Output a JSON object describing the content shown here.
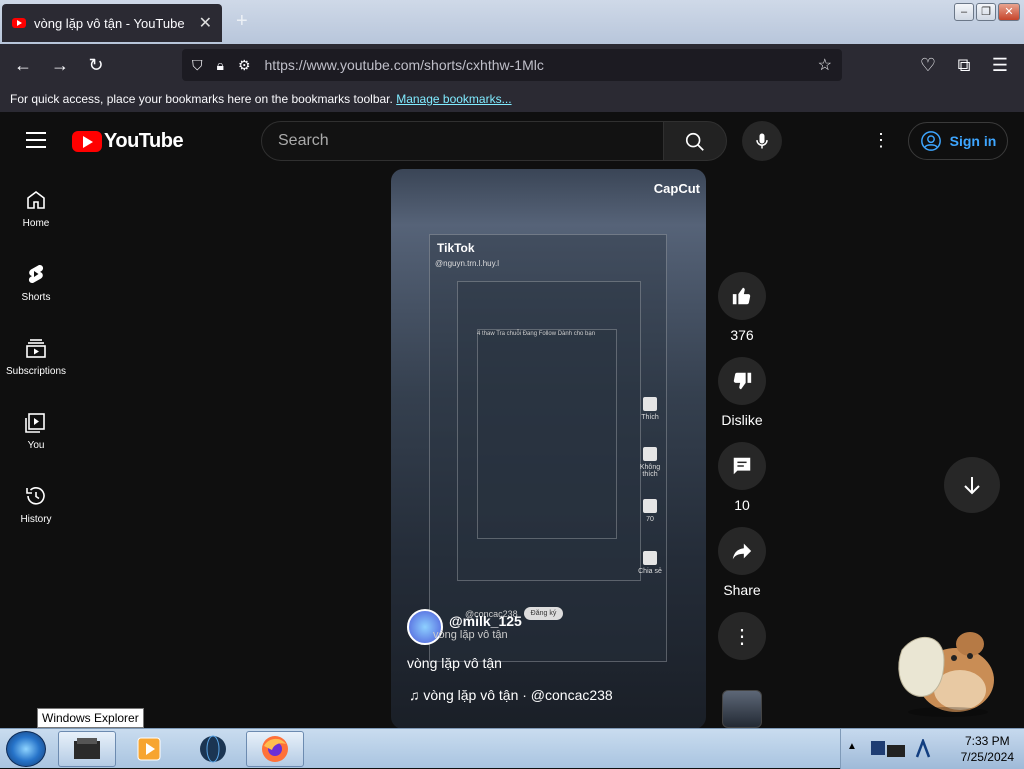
{
  "browser": {
    "tab_title": "vòng lặp vô tận - YouTube",
    "url": "https://www.youtube.com/shorts/cxhthw-1Mlc",
    "bookmark_text": "For quick access, place your bookmarks here on the bookmarks toolbar.",
    "bookmark_link": "Manage bookmarks..."
  },
  "youtube": {
    "logo_text": "YouTube",
    "search_placeholder": "Search",
    "sign_in": "Sign in",
    "sidebar": [
      {
        "label": "Home",
        "icon": "home-icon"
      },
      {
        "label": "Shorts",
        "icon": "shorts-icon"
      },
      {
        "label": "Subscriptions",
        "icon": "subscriptions-icon"
      },
      {
        "label": "You",
        "icon": "you-icon"
      },
      {
        "label": "History",
        "icon": "history-icon"
      }
    ],
    "short": {
      "capcut": "CapCut",
      "inner_tiktok": "TikTok",
      "inner_user": "@nguyn.trn.l.huy.l",
      "inner_tabs": "4 thaw    Tra chuỗi    Đang Follow    Dành cho bạn",
      "inner_handle": "@concac238",
      "inner_follow": "Đăng ký",
      "inner_like": "Thích",
      "inner_dislike": "Không thích",
      "inner_comments": "70",
      "inner_share": "Chia sẻ",
      "channel": "@milk_125",
      "channel_sub": "vòng lặp vô tận",
      "title": "vòng lặp vô tận",
      "music": "vòng lặp vô tận · @concac238"
    },
    "actions": {
      "likes": "376",
      "dislike": "Dislike",
      "comments": "10",
      "share": "Share"
    }
  },
  "taskbar": {
    "tooltip": "Windows Explorer",
    "time": "7:33 PM",
    "date": "7/25/2024"
  }
}
